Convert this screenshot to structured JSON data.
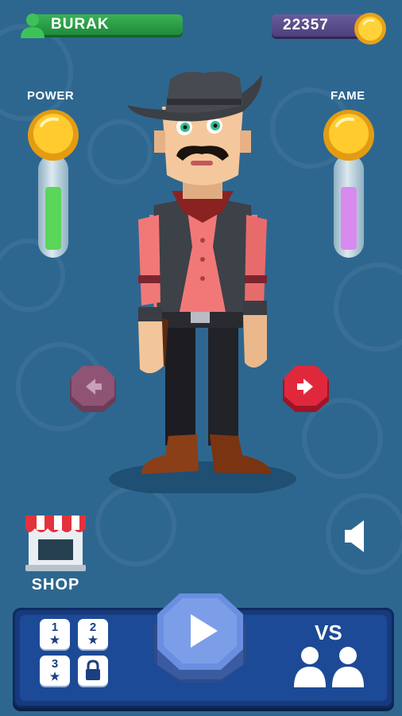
{
  "player": {
    "name": "BURAK",
    "icon": "user-icon"
  },
  "currency": {
    "amount": "22357",
    "icon": "gold-coin-icon"
  },
  "meters": [
    {
      "label": "POWER",
      "level": 0.72,
      "color": "#5ad65a"
    },
    {
      "label": "FAME",
      "level": 0.72,
      "color": "#d98aee"
    }
  ],
  "navigation": {
    "prev_icon": "arrow-left-icon",
    "next_icon": "arrow-right-icon"
  },
  "shop": {
    "label": "SHOP",
    "icon": "store-icon"
  },
  "sound": {
    "icon": "speaker-icon"
  },
  "bottom_panel": {
    "levels": [
      {
        "number": "1",
        "mark": "★"
      },
      {
        "number": "2",
        "mark": "★"
      },
      {
        "number": "3",
        "mark": "★"
      },
      {
        "number": "",
        "mark": "lock"
      }
    ],
    "play_icon": "play-icon",
    "vs_label": "VS",
    "vs_icon": "two-players-icon"
  },
  "colors": {
    "background": "#2d6790",
    "accent_green": "#2fa14b",
    "accent_purple": "#5a4d8c",
    "nav_next": "#d6263a",
    "nav_prev": "#8a4f6e",
    "play_button": "#5e7fd6"
  }
}
